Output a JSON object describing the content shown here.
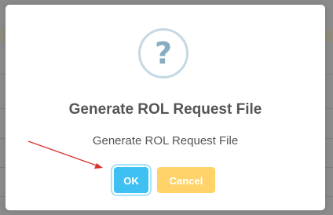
{
  "dialog": {
    "icon": "question-icon",
    "icon_glyph": "?",
    "title": "Generate ROL Request File",
    "message": "Generate ROL Request File",
    "ok_label": "OK",
    "cancel_label": "Cancel"
  },
  "colors": {
    "ok_button": "#3ec1f2",
    "cancel_button": "#ffd369",
    "icon_ring": "#c5d8e3",
    "icon_glyph": "#87adc0",
    "annotation_arrow": "#d9302c",
    "overlay": "#8b8b8b"
  }
}
